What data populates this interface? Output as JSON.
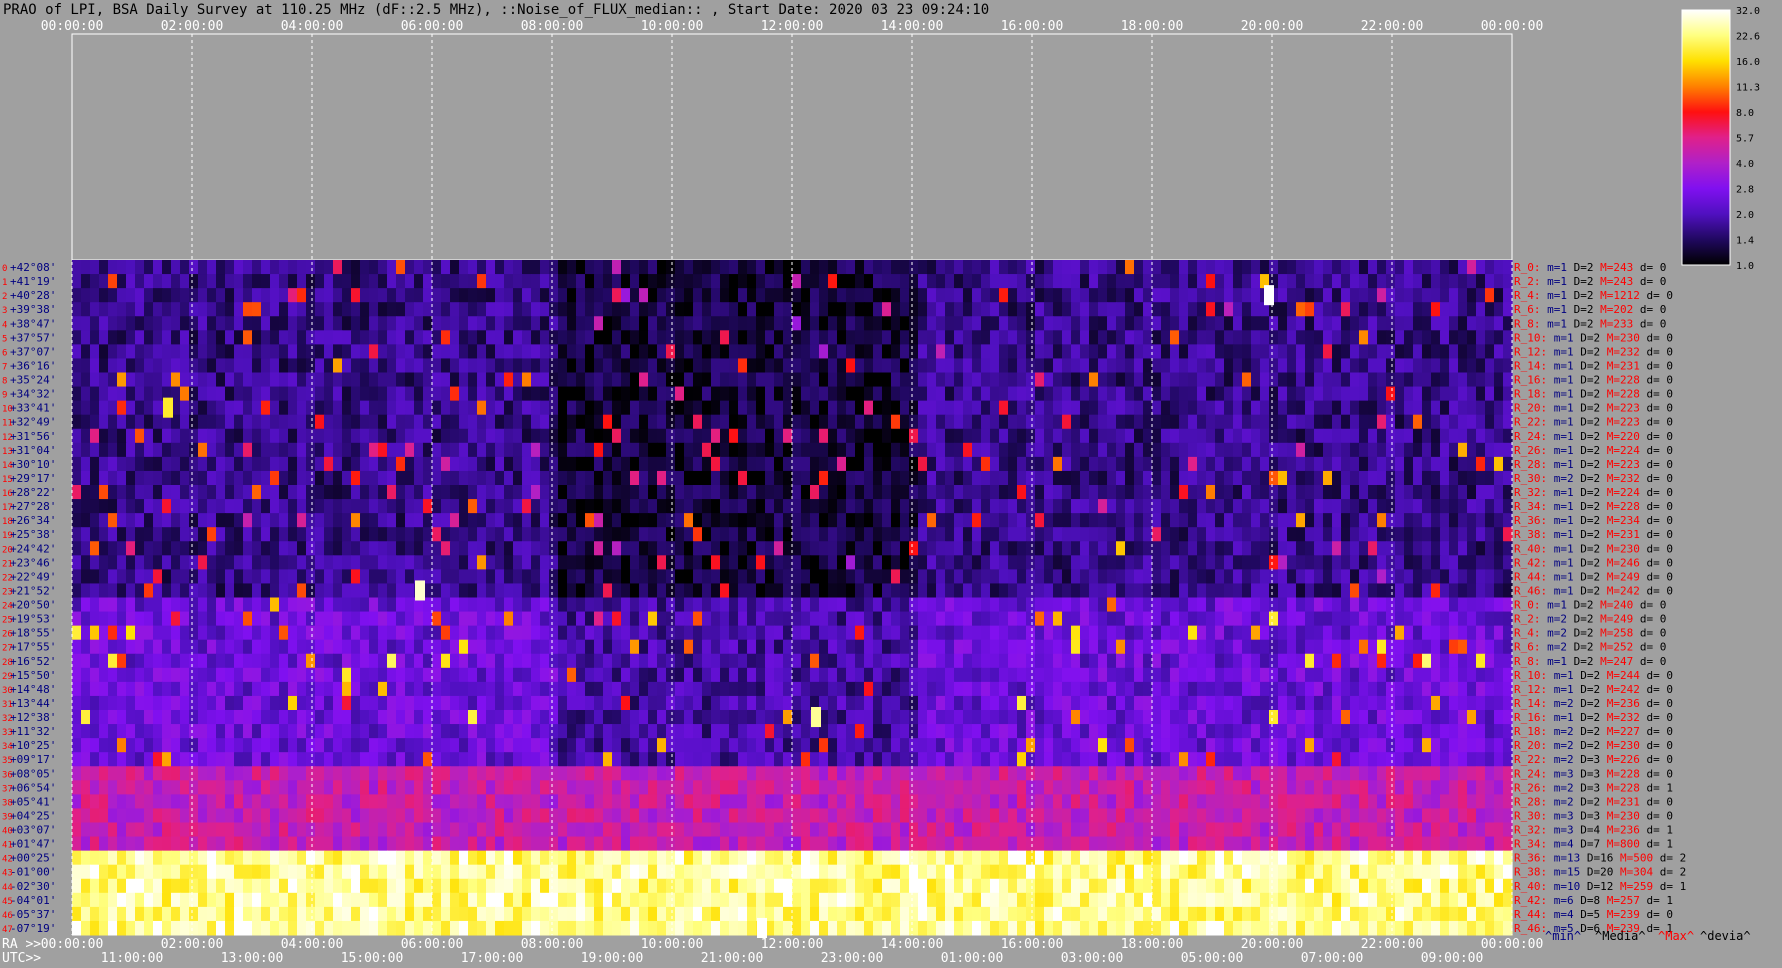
{
  "title": "PRAO of LPI, BSA Daily Survey at 110.25 MHz (dF::2.5 MHz), ::Noise_of_FLUX_median:: , Start Date: 2020 03 23 09:24:10",
  "top_axis_labels": [
    "00:00:00",
    "02:00:00",
    "04:00:00",
    "06:00:00",
    "08:00:00",
    "10:00:00",
    "12:00:00",
    "14:00:00",
    "16:00:00",
    "18:00:00",
    "20:00:00",
    "22:00:00",
    "00:00:00"
  ],
  "ra_prefix": "RA >>",
  "ra_labels": [
    "00:00:00",
    "02:00:00",
    "04:00:00",
    "06:00:00",
    "08:00:00",
    "10:00:00",
    "12:00:00",
    "14:00:00",
    "16:00:00",
    "18:00:00",
    "20:00:00",
    "22:00:00",
    "00:00:00"
  ],
  "utc_prefix": "UTC>>",
  "utc_labels": [
    "11:00:00",
    "13:00:00",
    "15:00:00",
    "17:00:00",
    "19:00:00",
    "21:00:00",
    "23:00:00",
    "01:00:00",
    "03:00:00",
    "05:00:00",
    "07:00:00",
    "09:00:00"
  ],
  "colorbar_ticks": [
    "32.0",
    "22.6",
    "16.0",
    "11.3",
    "8.0",
    "5.7",
    "4.0",
    "2.8",
    "2.0",
    "1.4",
    "1.0"
  ],
  "declinations": [
    "+42°08'",
    "+41°19'",
    "+40°28'",
    "+39°38'",
    "+38°47'",
    "+37°57'",
    "+37°07'",
    "+36°16'",
    "+35°24'",
    "+34°32'",
    "+33°41'",
    "+32°49'",
    "+31°56'",
    "+31°04'",
    "+30°10'",
    "+29°17'",
    "+28°22'",
    "+27°28'",
    "+26°34'",
    "+25°38'",
    "+24°42'",
    "+23°46'",
    "+22°49'",
    "+21°52'",
    "+20°50'",
    "+19°53'",
    "+18°55'",
    "+17°55'",
    "+16°52'",
    "+15°50'",
    "+14°48'",
    "+13°44'",
    "+12°38'",
    "+11°32'",
    "+10°25'",
    "+09°17'",
    "+08°05'",
    "+06°54'",
    "+05°41'",
    "+04°25'",
    "+03°07'",
    "+01°47'",
    "+00°25'",
    "-01°00'",
    "-02°30'",
    "-04°01'",
    "-05°37'",
    "-07°19'"
  ],
  "row_stats": [
    {
      "r": "R_0:",
      "m": "m=1",
      "d": "D=2",
      "h": "M=243",
      "dv": "d= 0"
    },
    {
      "r": "R_2:",
      "m": "m=1",
      "d": "D=2",
      "h": "M=243",
      "dv": "d= 0"
    },
    {
      "r": "R_4:",
      "m": "m=1",
      "d": "D=2",
      "h": "M=1212",
      "dv": "d= 0"
    },
    {
      "r": "R_6:",
      "m": "m=1",
      "d": "D=2",
      "h": "M=202",
      "dv": "d= 0"
    },
    {
      "r": "R_8:",
      "m": "m=1",
      "d": "D=2",
      "h": "M=233",
      "dv": "d= 0"
    },
    {
      "r": "R_10:",
      "m": "m=1",
      "d": "D=2",
      "h": "M=230",
      "dv": "d= 0"
    },
    {
      "r": "R_12:",
      "m": "m=1",
      "d": "D=2",
      "h": "M=232",
      "dv": "d= 0"
    },
    {
      "r": "R_14:",
      "m": "m=1",
      "d": "D=2",
      "h": "M=231",
      "dv": "d= 0"
    },
    {
      "r": "R_16:",
      "m": "m=1",
      "d": "D=2",
      "h": "M=228",
      "dv": "d= 0"
    },
    {
      "r": "R_18:",
      "m": "m=1",
      "d": "D=2",
      "h": "M=228",
      "dv": "d= 0"
    },
    {
      "r": "R_20:",
      "m": "m=1",
      "d": "D=2",
      "h": "M=223",
      "dv": "d= 0"
    },
    {
      "r": "R_22:",
      "m": "m=1",
      "d": "D=2",
      "h": "M=223",
      "dv": "d= 0"
    },
    {
      "r": "R_24:",
      "m": "m=1",
      "d": "D=2",
      "h": "M=220",
      "dv": "d= 0"
    },
    {
      "r": "R_26:",
      "m": "m=1",
      "d": "D=2",
      "h": "M=224",
      "dv": "d= 0"
    },
    {
      "r": "R_28:",
      "m": "m=1",
      "d": "D=2",
      "h": "M=223",
      "dv": "d= 0"
    },
    {
      "r": "R_30:",
      "m": "m=2",
      "d": "D=2",
      "h": "M=232",
      "dv": "d= 0"
    },
    {
      "r": "R_32:",
      "m": "m=1",
      "d": "D=2",
      "h": "M=224",
      "dv": "d= 0"
    },
    {
      "r": "R_34:",
      "m": "m=1",
      "d": "D=2",
      "h": "M=228",
      "dv": "d= 0"
    },
    {
      "r": "R_36:",
      "m": "m=1",
      "d": "D=2",
      "h": "M=234",
      "dv": "d= 0"
    },
    {
      "r": "R_38:",
      "m": "m=1",
      "d": "D=2",
      "h": "M=231",
      "dv": "d= 0"
    },
    {
      "r": "R_40:",
      "m": "m=1",
      "d": "D=2",
      "h": "M=230",
      "dv": "d= 0"
    },
    {
      "r": "R_42:",
      "m": "m=1",
      "d": "D=2",
      "h": "M=246",
      "dv": "d= 0"
    },
    {
      "r": "R_44:",
      "m": "m=1",
      "d": "D=2",
      "h": "M=249",
      "dv": "d= 0"
    },
    {
      "r": "R_46:",
      "m": "m=1",
      "d": "D=2",
      "h": "M=242",
      "dv": "d= 0"
    },
    {
      "r": "R_0:",
      "m": "m=1",
      "d": "D=2",
      "h": "M=240",
      "dv": "d= 0"
    },
    {
      "r": "R_2:",
      "m": "m=2",
      "d": "D=2",
      "h": "M=249",
      "dv": "d= 0"
    },
    {
      "r": "R_4:",
      "m": "m=2",
      "d": "D=2",
      "h": "M=258",
      "dv": "d= 0"
    },
    {
      "r": "R_6:",
      "m": "m=2",
      "d": "D=2",
      "h": "M=252",
      "dv": "d= 0"
    },
    {
      "r": "R_8:",
      "m": "m=1",
      "d": "D=2",
      "h": "M=247",
      "dv": "d= 0"
    },
    {
      "r": "R_10:",
      "m": "m=1",
      "d": "D=2",
      "h": "M=244",
      "dv": "d= 0"
    },
    {
      "r": "R_12:",
      "m": "m=1",
      "d": "D=2",
      "h": "M=242",
      "dv": "d= 0"
    },
    {
      "r": "R_14:",
      "m": "m=2",
      "d": "D=2",
      "h": "M=236",
      "dv": "d= 0"
    },
    {
      "r": "R_16:",
      "m": "m=1",
      "d": "D=2",
      "h": "M=232",
      "dv": "d= 0"
    },
    {
      "r": "R_18:",
      "m": "m=2",
      "d": "D=2",
      "h": "M=227",
      "dv": "d= 0"
    },
    {
      "r": "R_20:",
      "m": "m=2",
      "d": "D=2",
      "h": "M=230",
      "dv": "d= 0"
    },
    {
      "r": "R_22:",
      "m": "m=2",
      "d": "D=3",
      "h": "M=226",
      "dv": "d= 0"
    },
    {
      "r": "R_24:",
      "m": "m=3",
      "d": "D=3",
      "h": "M=228",
      "dv": "d= 0"
    },
    {
      "r": "R_26:",
      "m": "m=2",
      "d": "D=3",
      "h": "M=228",
      "dv": "d= 1"
    },
    {
      "r": "R_28:",
      "m": "m=2",
      "d": "D=2",
      "h": "M=231",
      "dv": "d= 0"
    },
    {
      "r": "R_30:",
      "m": "m=3",
      "d": "D=3",
      "h": "M=230",
      "dv": "d= 0"
    },
    {
      "r": "R_32:",
      "m": "m=3",
      "d": "D=4",
      "h": "M=236",
      "dv": "d= 1"
    },
    {
      "r": "R_34:",
      "m": "m=4",
      "d": "D=7",
      "h": "M=800",
      "dv": "d= 1"
    },
    {
      "r": "R_36:",
      "m": "m=13",
      "d": "D=16",
      "h": "M=500",
      "dv": "d= 2"
    },
    {
      "r": "R_38:",
      "m": "m=15",
      "d": "D=20",
      "h": "M=304",
      "dv": "d= 2"
    },
    {
      "r": "R_40:",
      "m": "m=10",
      "d": "D=12",
      "h": "M=259",
      "dv": "d= 1"
    },
    {
      "r": "R_42:",
      "m": "m=6",
      "d": "D=8",
      "h": "M=257",
      "dv": "d= 1"
    },
    {
      "r": "R_44:",
      "m": "m=4",
      "d": "D=5",
      "h": "M=239",
      "dv": "d= 0"
    },
    {
      "r": "R_46:",
      "m": "m=5",
      "d": "D=6",
      "h": "M=239",
      "dv": "d= 1"
    }
  ],
  "legend": {
    "min": "^min^",
    "median": "^Media^",
    "max": "^Max^",
    "dev": "^devia^"
  },
  "colors": {
    "background": "#a0a0a0",
    "red_text": "#ff0000",
    "navy_text": "#000080",
    "grid": "#ffffff"
  },
  "chart_data": {
    "type": "heatmap",
    "title": "PRAO of LPI, BSA Daily Survey at 110.25 MHz (dF::2.5 MHz), ::Noise_of_FLUX_median:: , Start Date: 2020 03 23 09:24:10",
    "x_axis": "RA (hours, 0-24)",
    "y_axis": "Declination (48 beams, +42°08' to -07°19')",
    "colorbar_range": [
      1.0,
      32.0
    ],
    "colorbar_scale": "log",
    "background_level_by_band": {
      "rows_0_23": 1.6,
      "rows_24_35": 2.4,
      "rows_36_41": 4.5,
      "rows_42_47": 22.0
    },
    "bright_features": [
      {
        "ra_h": 19.95,
        "beam": 2,
        "level": 32
      },
      {
        "ra_h": 5.8,
        "beam": 23,
        "level": 28
      },
      {
        "ra_h": 12.4,
        "beam": 32,
        "level": 24
      },
      {
        "ra_h": 1.6,
        "beam": 10,
        "level": 18
      },
      {
        "ra_h": 11.5,
        "beam": 47,
        "level": 32
      }
    ]
  }
}
